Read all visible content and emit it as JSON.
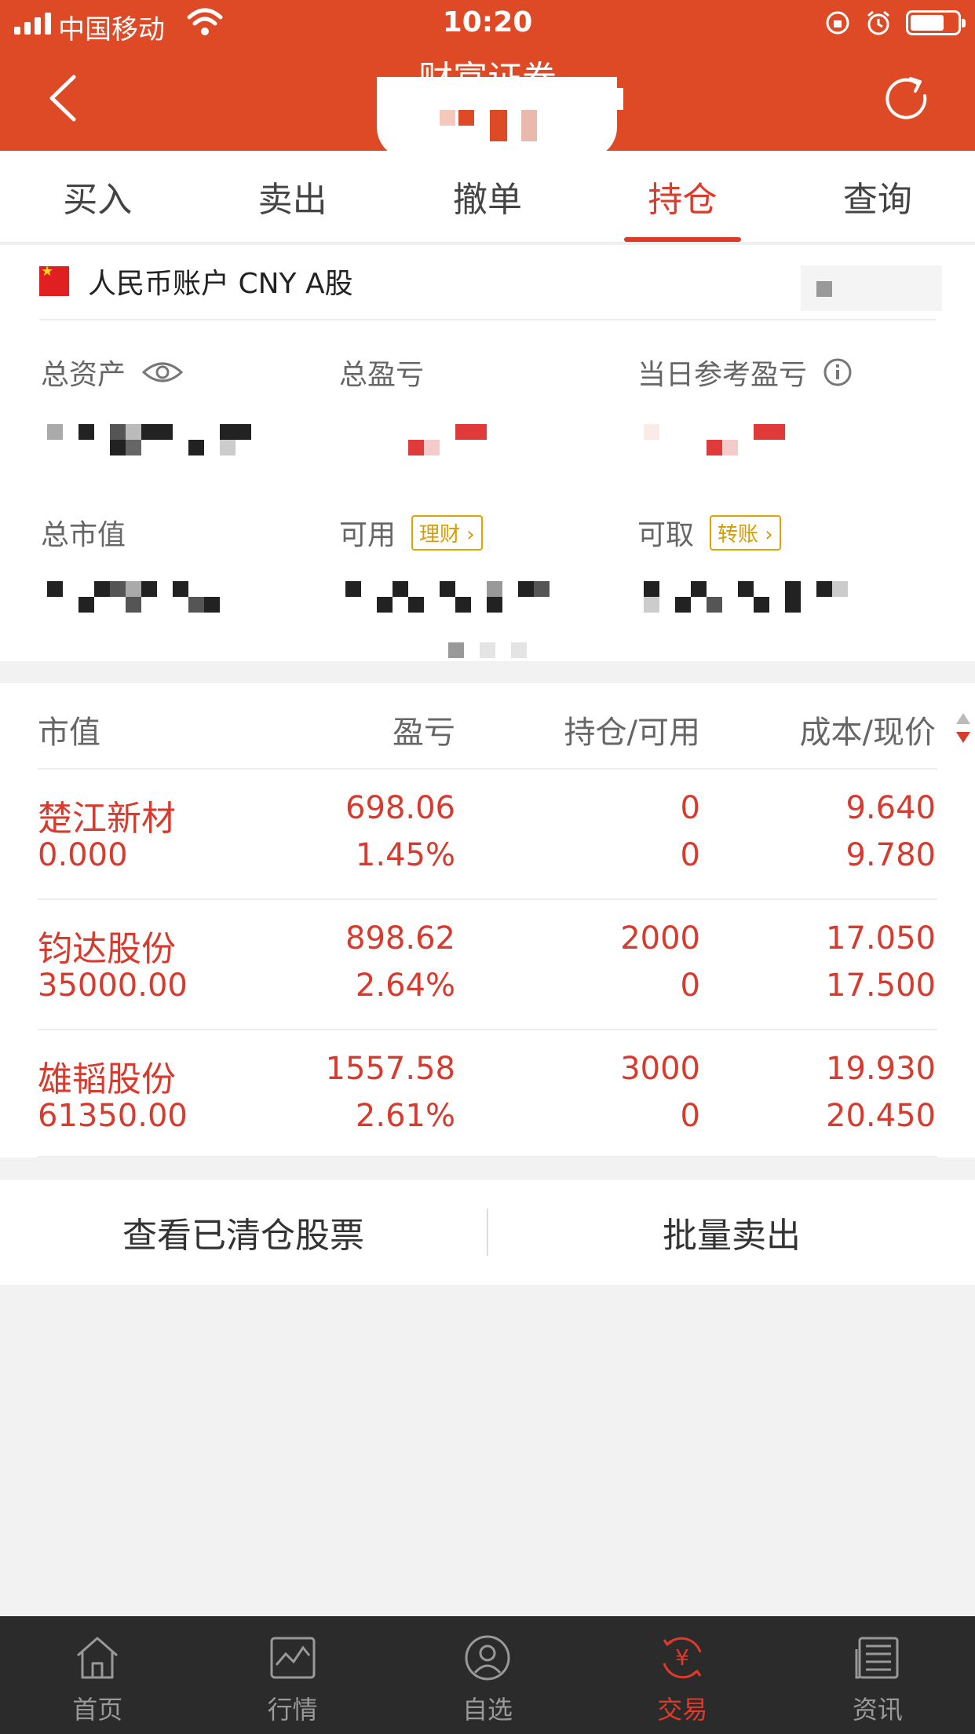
{
  "status_bar": {
    "carrier": "中国移动",
    "time": "10:20"
  },
  "header": {
    "title": "财富证券"
  },
  "tabs": [
    {
      "label": "买入"
    },
    {
      "label": "卖出"
    },
    {
      "label": "撤单"
    },
    {
      "label": "持仓",
      "active": true
    },
    {
      "label": "查询"
    }
  ],
  "account": {
    "label": "人民币账户 CNY A股"
  },
  "metrics": {
    "total_assets": "总资产",
    "total_pnl": "总盈亏",
    "daily_pnl": "当日参考盈亏",
    "market_value": "总市值",
    "available": "可用",
    "available_pill": "理财",
    "withdrawable": "可取",
    "withdrawable_pill": "转账"
  },
  "holdings": {
    "headers": [
      "市值",
      "盈亏",
      "持仓/可用",
      "成本/现价"
    ],
    "rows": [
      {
        "name": "楚江新材",
        "market_value": "0.000",
        "pnl": "698.06",
        "pnl_pct": "1.45%",
        "position": "0",
        "available": "0",
        "cost": "9.640",
        "price": "9.780"
      },
      {
        "name": "钧达股份",
        "market_value": "35000.00",
        "pnl": "898.62",
        "pnl_pct": "2.64%",
        "position": "2000",
        "available": "0",
        "cost": "17.050",
        "price": "17.500"
      },
      {
        "name": "雄韬股份",
        "market_value": "61350.00",
        "pnl": "1557.58",
        "pnl_pct": "2.61%",
        "position": "3000",
        "available": "0",
        "cost": "19.930",
        "price": "20.450"
      }
    ]
  },
  "actions": {
    "view_cleared": "查看已清仓股票",
    "batch_sell": "批量卖出"
  },
  "tabbar": [
    {
      "label": "首页",
      "icon": "home-icon"
    },
    {
      "label": "行情",
      "icon": "market-chart-icon"
    },
    {
      "label": "自选",
      "icon": "watchlist-icon"
    },
    {
      "label": "交易",
      "icon": "trade-yen-icon",
      "active": true
    },
    {
      "label": "资讯",
      "icon": "news-icon"
    }
  ],
  "colors": {
    "brand": "#dd4a25",
    "gain": "#d83a2d",
    "tabbar_bg": "#2b2b2b"
  }
}
